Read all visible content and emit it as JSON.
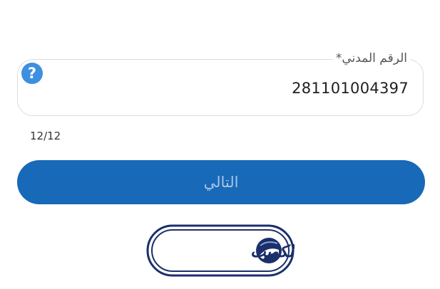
{
  "form": {
    "civil_id_label": "الرقم المدني*",
    "civil_id_value": "281101004397",
    "char_counter": "12/12",
    "help_icon": "question-mark-icon",
    "next_button_label": "التالي"
  },
  "brand": {
    "logo_text": "درب الكويت"
  },
  "colors": {
    "primary_button": "#1869b8",
    "button_text": "#a9c6e6",
    "help_icon": "#3d8fe0",
    "logo_navy": "#1b2f6b",
    "field_border": "#dcdcdc"
  }
}
